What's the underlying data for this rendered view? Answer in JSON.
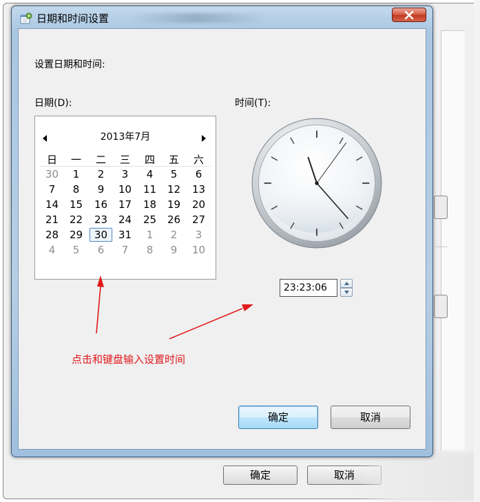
{
  "background_window": {
    "ok_label": "确定",
    "cancel_label": "取消"
  },
  "dialog": {
    "title": "日期和时间设置",
    "heading": "设置日期和时间:",
    "date_label": "日期(D):",
    "time_label": "时间(T):",
    "ok_label": "确定",
    "cancel_label": "取消"
  },
  "calendar": {
    "month_title": "2013年7月",
    "weekdays": [
      "日",
      "一",
      "二",
      "三",
      "四",
      "五",
      "六"
    ],
    "weeks": [
      [
        {
          "d": "30",
          "other": true
        },
        {
          "d": "1"
        },
        {
          "d": "2"
        },
        {
          "d": "3"
        },
        {
          "d": "4"
        },
        {
          "d": "5"
        },
        {
          "d": "6"
        }
      ],
      [
        {
          "d": "7"
        },
        {
          "d": "8"
        },
        {
          "d": "9"
        },
        {
          "d": "10"
        },
        {
          "d": "11"
        },
        {
          "d": "12"
        },
        {
          "d": "13"
        }
      ],
      [
        {
          "d": "14"
        },
        {
          "d": "15"
        },
        {
          "d": "16"
        },
        {
          "d": "17"
        },
        {
          "d": "18"
        },
        {
          "d": "19"
        },
        {
          "d": "20"
        }
      ],
      [
        {
          "d": "21"
        },
        {
          "d": "22"
        },
        {
          "d": "23"
        },
        {
          "d": "24"
        },
        {
          "d": "25"
        },
        {
          "d": "26"
        },
        {
          "d": "27"
        }
      ],
      [
        {
          "d": "28"
        },
        {
          "d": "29"
        },
        {
          "d": "30",
          "selected": true
        },
        {
          "d": "31"
        },
        {
          "d": "1",
          "other": true
        },
        {
          "d": "2",
          "other": true
        },
        {
          "d": "3",
          "other": true
        }
      ],
      [
        {
          "d": "4",
          "other": true
        },
        {
          "d": "5",
          "other": true
        },
        {
          "d": "6",
          "other": true
        },
        {
          "d": "7",
          "other": true
        },
        {
          "d": "8",
          "other": true
        },
        {
          "d": "9",
          "other": true
        },
        {
          "d": "10",
          "other": true
        }
      ]
    ]
  },
  "clock": {
    "hours": 23,
    "minutes": 23,
    "seconds": 6
  },
  "time_value": "23:23:06",
  "annotation": {
    "text": "点击和键盘输入设置时间",
    "color": "#e0191c"
  },
  "icons": {
    "title": "calendar-settings-icon",
    "close": "close-icon",
    "prev": "triangle-left-icon",
    "next": "triangle-right-icon",
    "spin_up": "chevron-up-icon",
    "spin_down": "chevron-down-icon"
  }
}
